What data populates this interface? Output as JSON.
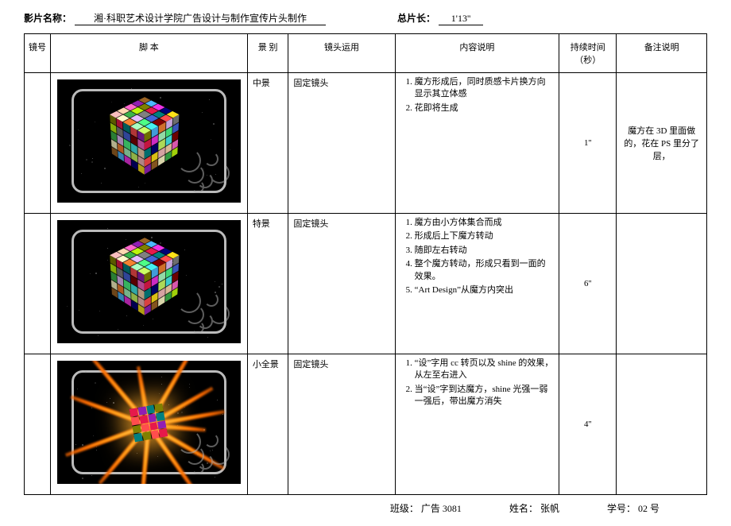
{
  "header": {
    "film_label": "影片名称：",
    "film_title": "    湘·科职艺术设计学院广告设计与制作宣传片头制作    ",
    "duration_label": "总片长：",
    "total_duration": "1'13''"
  },
  "columns": {
    "shot": "镜号",
    "script": "脚    本",
    "scene": "景    别",
    "lens": "镜头运用",
    "desc": "内容说明",
    "dur": "持续时间（秒）",
    "note": "备注说明"
  },
  "rows": [
    {
      "shot": "",
      "scene": "中景",
      "lens": "固定镜头",
      "desc": [
        "魔方形成后，同时质感卡片换方向显示其立体感",
        "花即将生成"
      ],
      "dur": "1''",
      "note": "魔方在 3D 里面做的，花在 PS 里分了层，"
    },
    {
      "shot": "",
      "scene": "特景",
      "lens": "固定镜头",
      "desc": [
        "魔方由小方体集合而成",
        "形成后上下魔方转动",
        "随即左右转动",
        "整个魔方转动，形成只看到一面的效果。",
        "“Art Design”从魔方内突出"
      ],
      "dur": "6''",
      "note": ""
    },
    {
      "shot": "",
      "scene": "小全景",
      "lens": "固定镜头",
      "desc": [
        "“设”字用 cc 转页以及 shine 的效果，从左至右进入",
        "当“设”字到达魔方，shine 光强一弱一强后，带出魔方消失"
      ],
      "dur": "4''",
      "note": ""
    }
  ],
  "footer": {
    "class_label": "班级：",
    "class_value": "广告 3081",
    "name_label": "姓名：",
    "name_value": "张帆",
    "id_label": "学号：",
    "id_value": "02 号"
  },
  "palette": [
    "#e6194b",
    "#3cb44b",
    "#ffe119",
    "#4363d8",
    "#f58231",
    "#911eb4",
    "#46f0f0",
    "#f032e6",
    "#bcf60c",
    "#fabebe",
    "#008080",
    "#e6beff",
    "#9a6324",
    "#800000",
    "#aaffc3",
    "#808000",
    "#ffd8b1",
    "#000075",
    "#808080",
    "#fffac8",
    "#ff4d4d",
    "#4dff88",
    "#4db8ff",
    "#ff66cc",
    "#ccff66"
  ]
}
